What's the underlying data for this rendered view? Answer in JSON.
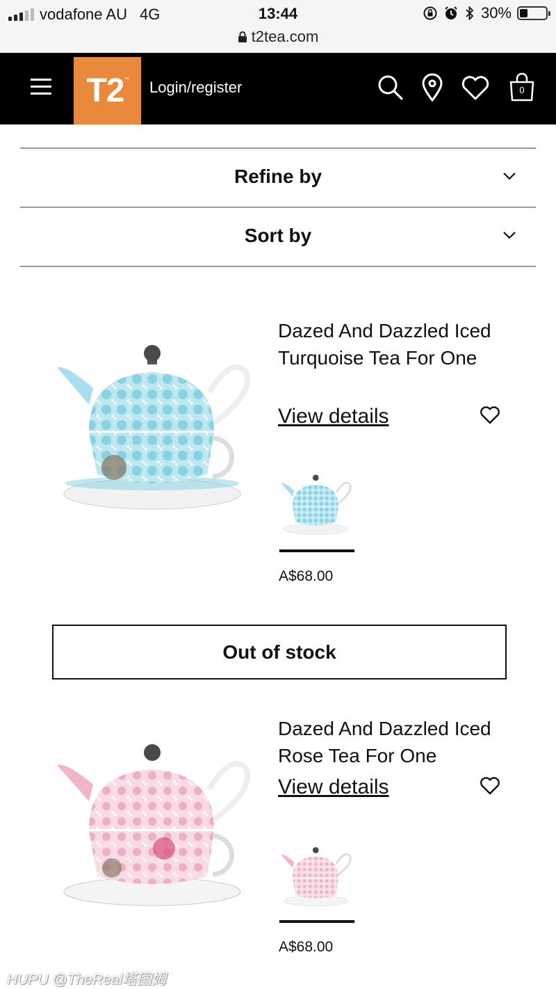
{
  "status_bar": {
    "carrier": "vodafone AU",
    "network": "4G",
    "time": "13:44",
    "battery": "30%",
    "battery_level": 0.3,
    "url": "t2tea.com"
  },
  "header": {
    "logo": "T2",
    "logo_tm": "™",
    "login_label": "Login/register",
    "bag_count": "0"
  },
  "filters": {
    "refine_label": "Refine by",
    "sort_label": "Sort by"
  },
  "products": [
    {
      "title": "Dazed And Dazzled Iced Turquoise Tea For One",
      "view_label": "View details",
      "price": "A$68.00",
      "colorway": "turquoise"
    },
    {
      "title": "Dazed And Dazzled Iced Rose Tea For One",
      "view_label": "View details",
      "price": "A$68.00",
      "colorway": "rose"
    }
  ],
  "out_of_stock_label": "Out of stock",
  "watermark": "HUPU @TheReal塔图姆",
  "colors": {
    "header_bg": "#000000",
    "logo_bg": "#e8893b",
    "turquoise": "#5ec4d8",
    "rose": "#e89bb4"
  }
}
